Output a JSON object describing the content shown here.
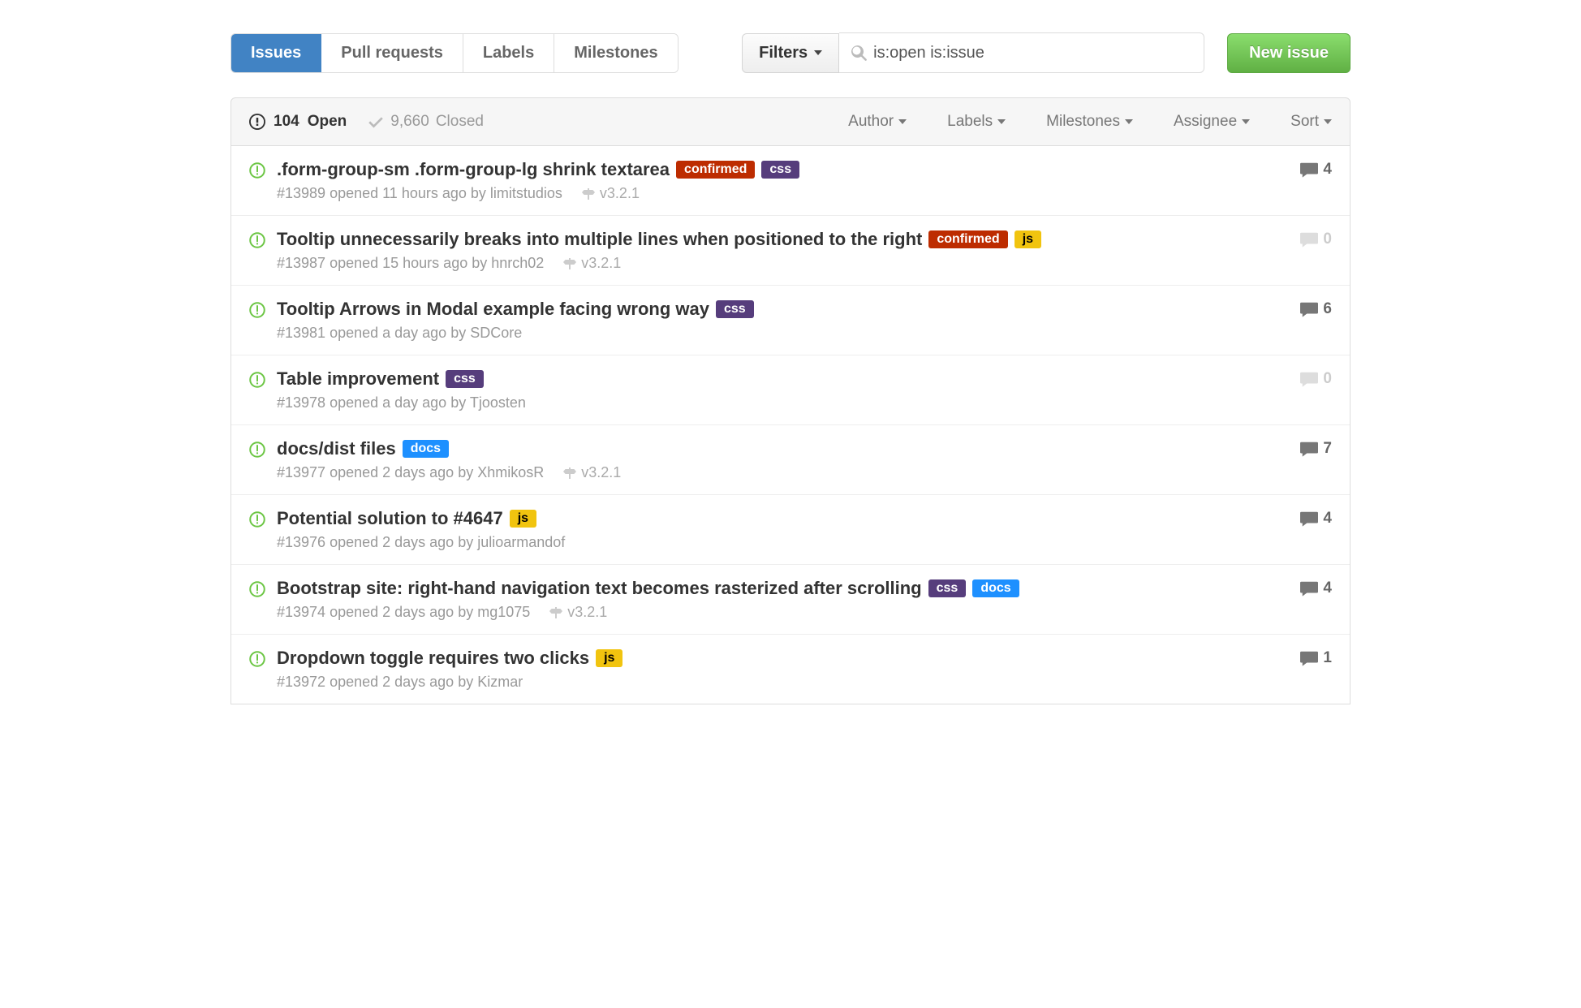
{
  "nav": {
    "issues": "Issues",
    "pulls": "Pull requests",
    "labels": "Labels",
    "milestones": "Milestones"
  },
  "filters_button": "Filters",
  "search": {
    "value": "is:open is:issue"
  },
  "new_issue": "New issue",
  "states": {
    "open_count": "104",
    "open_label": "Open",
    "closed_count": "9,660",
    "closed_label": "Closed"
  },
  "filter_menus": {
    "author": "Author",
    "labels": "Labels",
    "milestones": "Milestones",
    "assignee": "Assignee",
    "sort": "Sort"
  },
  "label_colors": {
    "confirmed": "#bd2c00",
    "css": "#563d7c",
    "js": "#f1c40f",
    "docs": "#1e90ff"
  },
  "issues": [
    {
      "title": ".form-group-sm .form-group-lg shrink textarea",
      "labels": [
        {
          "text": "confirmed",
          "color": "confirmed"
        },
        {
          "text": "css",
          "color": "css"
        }
      ],
      "meta": "#13989 opened 11 hours ago by limitstudios",
      "milestone": "v3.2.1",
      "comments": 4,
      "has_comments": true
    },
    {
      "title": "Tooltip unnecessarily breaks into multiple lines when positioned to the right",
      "labels": [
        {
          "text": "confirmed",
          "color": "confirmed"
        },
        {
          "text": "js",
          "color": "js",
          "dark": true
        }
      ],
      "meta": "#13987 opened 15 hours ago by hnrch02",
      "milestone": "v3.2.1",
      "comments": 0,
      "has_comments": false
    },
    {
      "title": "Tooltip Arrows in Modal example facing wrong way",
      "labels": [
        {
          "text": "css",
          "color": "css"
        }
      ],
      "meta": "#13981 opened a day ago by SDCore",
      "milestone": "",
      "comments": 6,
      "has_comments": true
    },
    {
      "title": "Table improvement",
      "labels": [
        {
          "text": "css",
          "color": "css"
        }
      ],
      "meta": "#13978 opened a day ago by Tjoosten",
      "milestone": "",
      "comments": 0,
      "has_comments": false
    },
    {
      "title": "docs/dist files",
      "labels": [
        {
          "text": "docs",
          "color": "docs"
        }
      ],
      "meta": "#13977 opened 2 days ago by XhmikosR",
      "milestone": "v3.2.1",
      "comments": 7,
      "has_comments": true
    },
    {
      "title": "Potential solution to #4647",
      "labels": [
        {
          "text": "js",
          "color": "js",
          "dark": true
        }
      ],
      "meta": "#13976 opened 2 days ago by julioarmandof",
      "milestone": "",
      "comments": 4,
      "has_comments": true
    },
    {
      "title": "Bootstrap site: right-hand navigation text becomes rasterized after scrolling",
      "labels": [
        {
          "text": "css",
          "color": "css"
        },
        {
          "text": "docs",
          "color": "docs"
        }
      ],
      "meta": "#13974 opened 2 days ago by mg1075",
      "milestone": "v3.2.1",
      "comments": 4,
      "has_comments": true
    },
    {
      "title": "Dropdown toggle requires two clicks",
      "labels": [
        {
          "text": "js",
          "color": "js",
          "dark": true
        }
      ],
      "meta": "#13972 opened 2 days ago by Kizmar",
      "milestone": "",
      "comments": 1,
      "has_comments": true
    }
  ]
}
